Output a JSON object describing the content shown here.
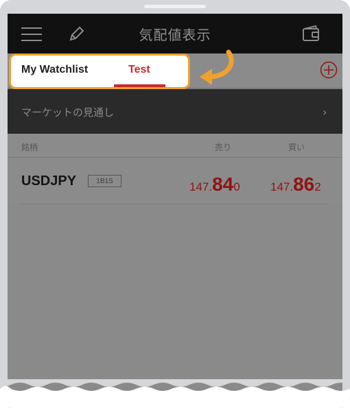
{
  "header": {
    "title": "気配値表示"
  },
  "tabs": [
    {
      "label": "My Watchlist"
    },
    {
      "label": "Test"
    }
  ],
  "market_outlook": {
    "label": "マーケットの見通し"
  },
  "list_header": {
    "symbol": "銘柄",
    "sell": "売り",
    "buy": "買い"
  },
  "rows": [
    {
      "symbol": "USDJPY",
      "badge": "1B1S",
      "sell": {
        "prefix": "147.",
        "big": "84",
        "suffix": "0"
      },
      "buy": {
        "prefix": "147.",
        "big": "86",
        "suffix": "2"
      }
    }
  ],
  "colors": {
    "accent": "#c92a2a",
    "highlight": "#f0a02c",
    "price": "#8e1414"
  }
}
